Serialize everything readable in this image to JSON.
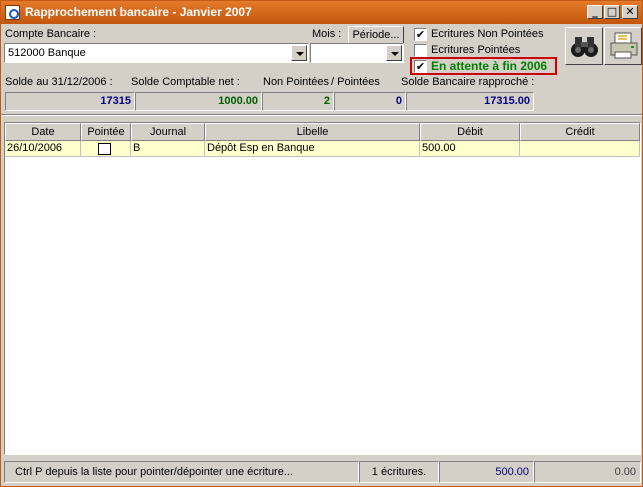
{
  "window": {
    "title": "Rapprochement bancaire - Janvier 2007",
    "minimize_glyph": "_",
    "maximize_glyph": "□",
    "close_glyph": "✕"
  },
  "filters": {
    "account_label": "Compte Bancaire :",
    "account_value": "512000 Banque",
    "month_label": "Mois :",
    "period_button": "Période...",
    "month_value": "",
    "checkboxes": [
      {
        "label": "Ecritures Non Pointées",
        "checked": true,
        "glyph": "✔"
      },
      {
        "label": "Ecritures Pointées",
        "checked": false,
        "glyph": ""
      },
      {
        "label": "En attente à fin 2006",
        "checked": true,
        "glyph": "✔"
      }
    ],
    "highlight_color": "#cc0000",
    "green_text_color": "#008000"
  },
  "toolbar": {
    "icons": [
      "binoculars-icon",
      "printer-icon"
    ]
  },
  "summary": {
    "balance_label": "Solde au 31/12/2006 :",
    "balance_value": "17315",
    "book_label": "Solde Comptable net :",
    "book_value": "1000.00",
    "unpointed_label": "Non Pointées",
    "pointed_label": "/ Pointées",
    "unpointed_value": "2",
    "pointed_value": "0",
    "reconciled_label": "Solde Bancaire rapproché :",
    "reconciled_value": "17315.00",
    "blue_color": "#000080",
    "green_color": "#006000"
  },
  "grid": {
    "columns": [
      "Date",
      "Pointée",
      "Journal",
      "Libelle",
      "Débit",
      "Crédit"
    ],
    "rows": [
      {
        "date": "26/10/2006",
        "pointee": false,
        "journal": "B",
        "libelle": "Dépôt Esp en Banque",
        "debit": "500.00",
        "credit": ""
      }
    ],
    "row_highlight": "#ffffcc"
  },
  "status": {
    "hint": "Ctrl P depuis la liste pour pointer/dépointer une écriture...",
    "count": "1 écritures.",
    "debit_total": "500.00",
    "credit_total": "0.00"
  }
}
